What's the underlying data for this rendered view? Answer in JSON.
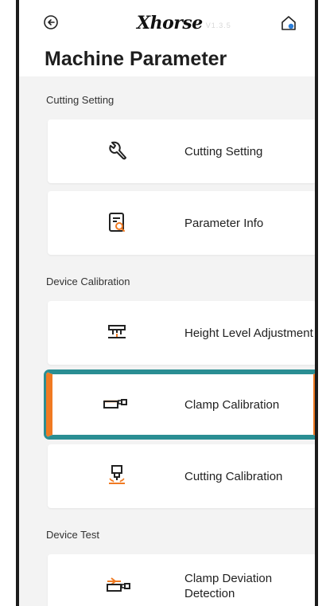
{
  "header": {
    "logo": "Xhorse",
    "version": "V1.3.5",
    "title": "Machine Parameter"
  },
  "sections": [
    {
      "label": "Cutting Setting",
      "items": [
        {
          "label": "Cutting Setting",
          "icon": "wrench-icon"
        },
        {
          "label": "Parameter Info",
          "icon": "document-search-icon"
        }
      ]
    },
    {
      "label": "Device Calibration",
      "items": [
        {
          "label": "Height Level Adjustment",
          "icon": "height-level-icon"
        },
        {
          "label": "Clamp Calibration",
          "icon": "clamp-icon",
          "selected": true
        },
        {
          "label": "Cutting Calibration",
          "icon": "cutter-calibration-icon"
        }
      ]
    },
    {
      "label": "Device Test",
      "items": [
        {
          "label": "Clamp Deviation\nDetection",
          "icon": "clamp-deviation-icon"
        }
      ]
    }
  ],
  "colors": {
    "accent_orange": "#f07a22",
    "selection_teal": "#2a8e93",
    "background": "#f3f3f3"
  }
}
